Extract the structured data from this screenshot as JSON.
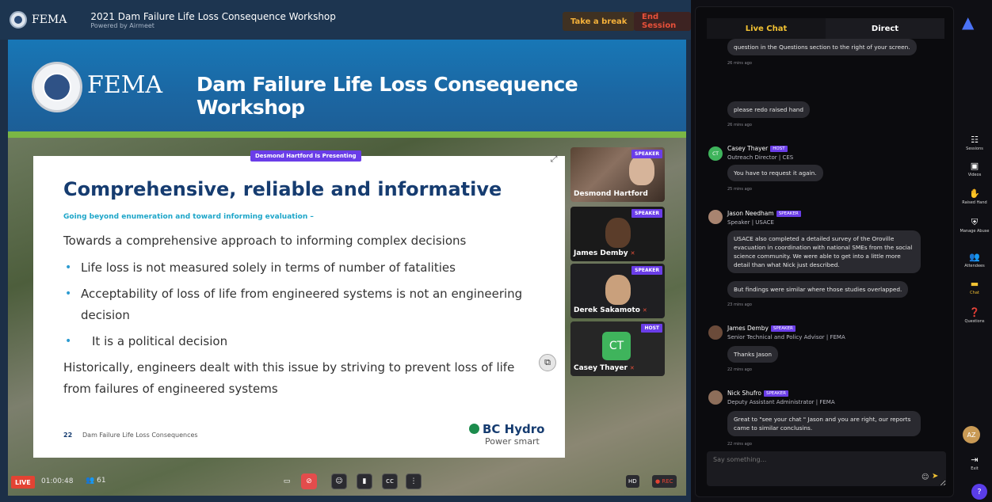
{
  "header": {
    "org": "FEMA",
    "event_title": "2021 Dam Failure Life Loss Consequence Workshop",
    "powered_by": "Powered by Airmeet",
    "take_break": "Take a break",
    "end_session": "End Session"
  },
  "banner": {
    "org": "FEMA",
    "title": "Dam Failure Life Loss Consequence Workshop"
  },
  "slide": {
    "presenting": "Desmond Hartford Is Presenting",
    "title": "Comprehensive, reliable and informative",
    "subtitle": "Going beyond enumeration and toward informing evaluation –",
    "lines": [
      "Towards a comprehensive approach to informing complex decisions",
      "Life loss is not measured solely in terms of number of fatalities",
      "Acceptability of loss of life from engineered systems is not an engineering",
      "decision",
      "It is a political decision",
      "Historically, engineers dealt with this issue by striving to prevent loss of life",
      "from failures of engineered systems"
    ],
    "bullet": "•",
    "page_num": "22",
    "footer": "Dam Failure Life Loss Consequences",
    "brand": "BC Hydro",
    "brand_tag": "Power smart"
  },
  "speakers": [
    {
      "name": "Desmond Hartford",
      "role": "SPEAKER"
    },
    {
      "name": "James Demby",
      "role": "SPEAKER"
    },
    {
      "name": "Derek Sakamoto",
      "role": "SPEAKER"
    },
    {
      "name": "Casey Thayer",
      "role": "HOST",
      "initials": "CT"
    }
  ],
  "controls": {
    "live": "LIVE",
    "timer": "01:00:48",
    "viewers": "61",
    "hd": "HD",
    "rec": "REC"
  },
  "chat": {
    "tab_live": "Live Chat",
    "tab_direct": "Direct",
    "messages": [
      {
        "text": "question in the Questions section to the right of your screen.",
        "time": "26 mins ago"
      },
      {
        "text": "please redo raised hand",
        "time": "26 mins ago"
      },
      {
        "author": "Casey Thayer",
        "badge": "HOST",
        "role": "Outreach Director | CES",
        "initials": "CT",
        "text": "You have to request it again.",
        "time": "25 mins ago"
      },
      {
        "author": "Jason Needham",
        "badge": "SPEAKER",
        "role": "Speaker | USACE",
        "text": "USACE also completed a detailed survey of the Oroville evacuation in coordination with national SMEs from the social science community. We were able to get into a little more detail than what Nick just described.",
        "text2": "But findings were similar where those studies overlapped.",
        "time": "23 mins ago"
      },
      {
        "author": "James Demby",
        "badge": "SPEAKER",
        "role": "Senior Technical and Policy Advisor | FEMA",
        "text": "Thanks Jason",
        "time": "22 mins ago"
      },
      {
        "author": "Nick Shufro",
        "badge": "SPEAKER",
        "role": "Deputy Assistant Administrator | FEMA",
        "text": "Great to \"see your chat \" Jason and you are right, our reports came to similar conclusins.",
        "time": "22 mins ago"
      }
    ],
    "input_placeholder": "Say something..."
  },
  "sidenav": {
    "sessions": "Sessions",
    "videos": "Videos",
    "raised_hand": "Raised Hand",
    "manage_abuse": "Manage Abuse",
    "attendees": "Attendees",
    "chat": "Chat",
    "questions": "Questions",
    "exit": "Exit",
    "user_initials": "AZ",
    "help": "?"
  },
  "colors": {
    "accent_purple": "#6a3de8",
    "live_red": "#e34333",
    "chat_yellow": "#f2c233",
    "fema_blue": "#1b67a3"
  }
}
